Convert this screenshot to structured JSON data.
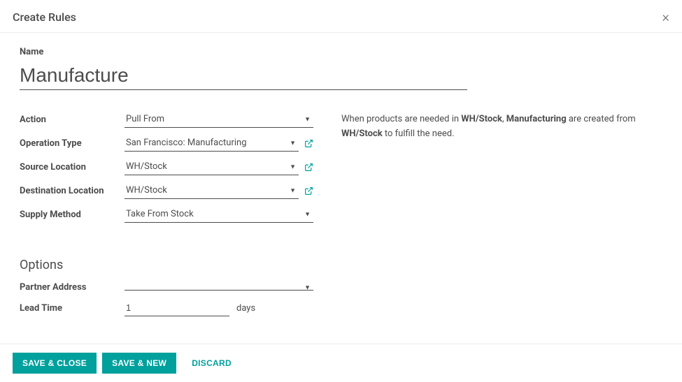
{
  "dialog": {
    "title": "Create Rules",
    "close": "×"
  },
  "name": {
    "label": "Name",
    "value": "Manufacture"
  },
  "fields": {
    "action": {
      "label": "Action",
      "value": "Pull From"
    },
    "operation_type": {
      "label": "Operation Type",
      "value": "San Francisco: Manufacturing"
    },
    "source_location": {
      "label": "Source Location",
      "value": "WH/Stock"
    },
    "destination_location": {
      "label": "Destination Location",
      "value": "WH/Stock"
    },
    "supply_method": {
      "label": "Supply Method",
      "value": "Take From Stock"
    }
  },
  "description": {
    "part1": "When products are needed in ",
    "bold1": "WH/Stock",
    "part2": ", ",
    "bold2": "Manufacturing",
    "part3": " are created from ",
    "bold3": "WH/Stock",
    "part4": " to fulfill the need."
  },
  "options": {
    "heading": "Options",
    "partner_address": {
      "label": "Partner Address",
      "value": ""
    },
    "lead_time": {
      "label": "Lead Time",
      "value": "1",
      "suffix": "days"
    }
  },
  "footer": {
    "save_close": "SAVE & CLOSE",
    "save_new": "SAVE & NEW",
    "discard": "DISCARD"
  }
}
